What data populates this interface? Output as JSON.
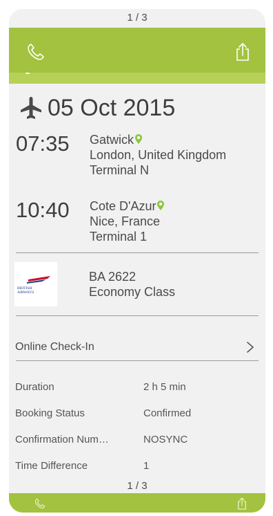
{
  "pager": {
    "top": "1 / 3",
    "bottom": "1 / 3"
  },
  "colors": {
    "accent": "#a3c23f",
    "card": "#f1f1f1",
    "text": "#3d3d3d"
  },
  "toolbar": {
    "left_icon": "phone-icon",
    "right_icon": "share-icon"
  },
  "date": "05 Oct 2015",
  "departure": {
    "time": "07:35",
    "airport": "Gatwick",
    "city": "London, United Kingdom",
    "terminal": "Terminal N"
  },
  "arrival": {
    "time": "10:40",
    "airport": "Cote D'Azur",
    "city": "Nice, France",
    "terminal": "Terminal 1"
  },
  "airline": {
    "logo_text_1": "BRITISH",
    "logo_text_2": "AIRWAYS",
    "flight": "BA 2622",
    "class": "Economy Class"
  },
  "checkin": {
    "label": "Online Check-In"
  },
  "details": [
    {
      "label": "Duration",
      "value": "2 h 5 min"
    },
    {
      "label": "Booking Status",
      "value": "Confirmed"
    },
    {
      "label": "Confirmation Num…",
      "value": "NOSYNC"
    },
    {
      "label": "Time Difference",
      "value": "1"
    }
  ]
}
